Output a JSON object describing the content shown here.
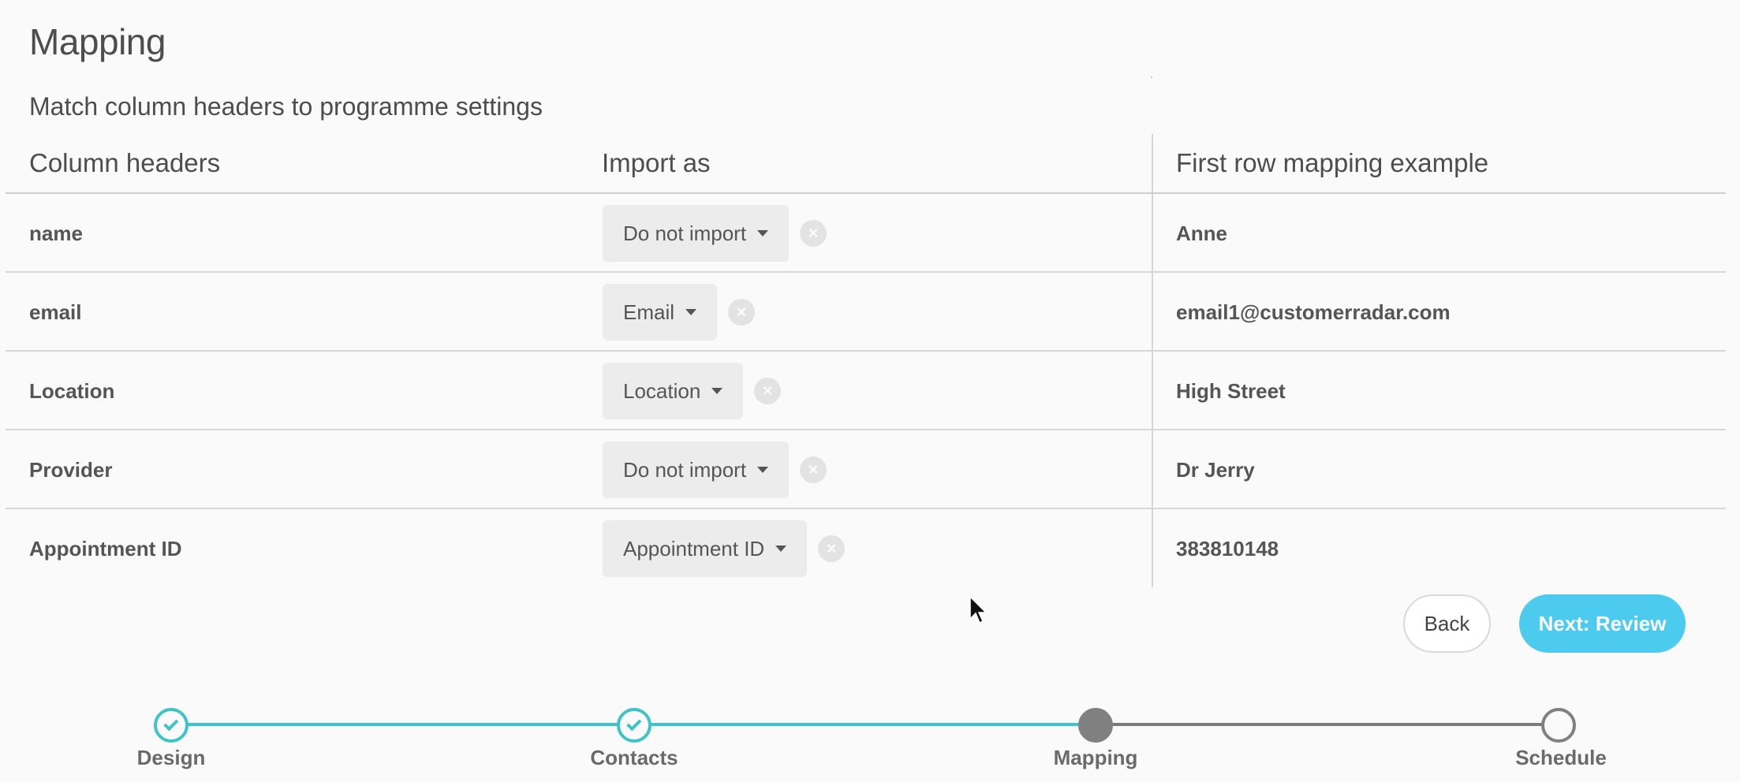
{
  "page": {
    "title": "Mapping",
    "subtitle": "Match column headers to programme settings"
  },
  "table": {
    "headers": [
      "Column headers",
      "Import as",
      "First row mapping example"
    ],
    "rows": [
      {
        "column": "name",
        "import_as": "Do not import",
        "example": "Anne"
      },
      {
        "column": "email",
        "import_as": "Email",
        "example": "email1@customerradar.com"
      },
      {
        "column": "Location",
        "import_as": "Location",
        "example": "High Street"
      },
      {
        "column": "Provider",
        "import_as": "Do not import",
        "example": "Dr Jerry"
      },
      {
        "column": "Appointment ID",
        "import_as": "Appointment ID",
        "example": "383810148"
      }
    ],
    "clear_glyph": "×"
  },
  "actions": {
    "back_label": "Back",
    "next_label": "Next: Review"
  },
  "stepper": {
    "steps": [
      {
        "label": "Design",
        "state": "done"
      },
      {
        "label": "Contacts",
        "state": "done"
      },
      {
        "label": "Mapping",
        "state": "current"
      },
      {
        "label": "Schedule",
        "state": "pending"
      }
    ]
  },
  "colors": {
    "accent_teal": "#3ec3c8",
    "primary_button": "#4ccbef",
    "inactive_step": "#808080"
  }
}
